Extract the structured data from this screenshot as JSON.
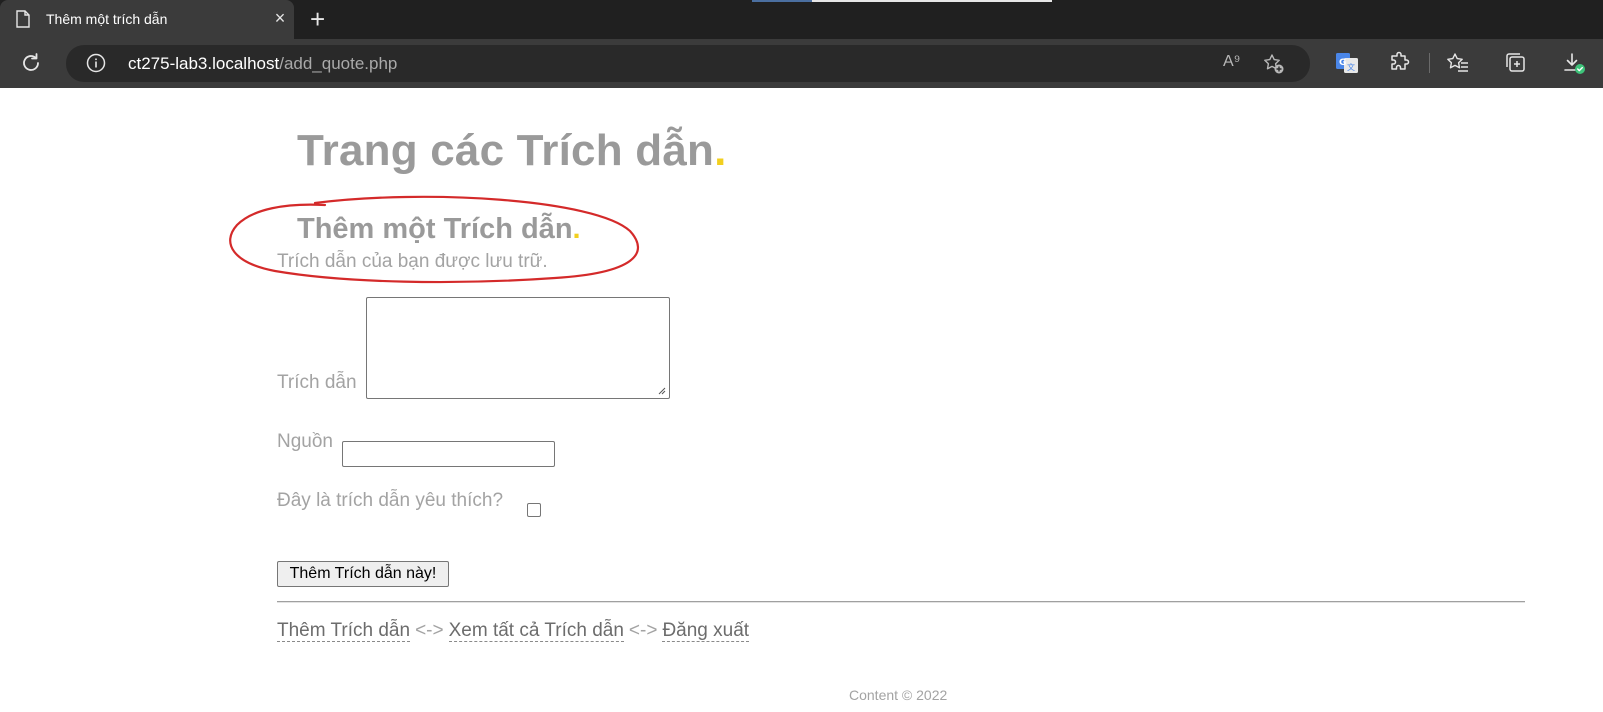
{
  "browser": {
    "tab_title": "Thêm một trích dẫn",
    "tab_close": "×",
    "new_tab": "+",
    "url_host": "ct275-lab3.localhost",
    "url_path": "/add_quote.php",
    "read_aloud": "A⁹"
  },
  "page": {
    "site_title": "Trang các Trích dẫn",
    "site_title_dot": ".",
    "heading": "Thêm một Trích dẫn",
    "heading_dot": ".",
    "status_message": "Trích dẫn của bạn được lưu trữ."
  },
  "form": {
    "quote_label": "Trích dẫn",
    "quote_value": "",
    "source_label": "Nguồn",
    "source_value": "",
    "favorite_label": "Đây là trích dẫn yêu thích?",
    "favorite_checked": false,
    "submit_label": "Thêm Trích dẫn này!"
  },
  "footer": {
    "links": [
      {
        "label": "Thêm Trích dẫn"
      },
      {
        "label": "Xem tất cả Trích dẫn"
      },
      {
        "label": "Đăng xuất"
      }
    ],
    "separator": "<->",
    "copyright": "Content © 2022"
  },
  "colors": {
    "accent_dot": "#f2cf1f",
    "annotation": "#d42a2a",
    "chrome_bg": "#3b3b3b"
  },
  "icons": [
    "document-icon",
    "reload-icon",
    "info-icon",
    "read-aloud-icon",
    "add-favorite-icon",
    "translate-icon",
    "extensions-icon",
    "favorites-icon",
    "collections-icon",
    "downloads-icon"
  ]
}
